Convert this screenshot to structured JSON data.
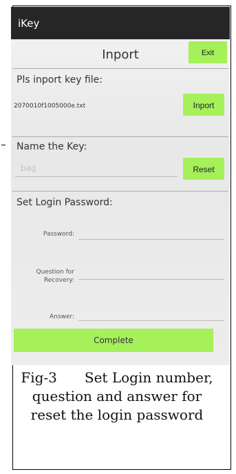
{
  "app": {
    "title": "iKey"
  },
  "header": {
    "title": "Inport",
    "exit_label": "Exit"
  },
  "import_section": {
    "label": "Pls inport key file:",
    "filename": "2070010f1005000e.txt",
    "button_label": "Inport"
  },
  "name_section": {
    "label": "Name the Key:",
    "input_value": "bag",
    "button_label": "Reset"
  },
  "password_section": {
    "label": "Set Login Password:",
    "fields": [
      {
        "label": "Password:"
      },
      {
        "label": "Question for Recovery:"
      },
      {
        "label": "Answer:"
      }
    ]
  },
  "complete_label": "Complete",
  "caption": "Fig-3  Set Login number, question and answer for reset the login password",
  "colors": {
    "accent": "#a6f05a",
    "app_bar": "#262626"
  }
}
